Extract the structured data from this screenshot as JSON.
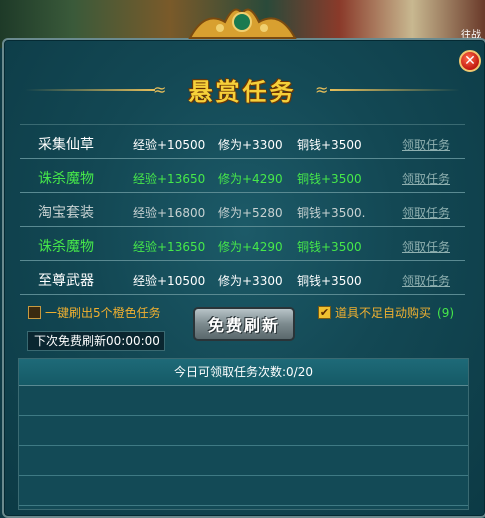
{
  "top": {
    "side_tag": "往战"
  },
  "title": "悬赏任务",
  "tasks": [
    {
      "name": "采集仙草",
      "exp": "经验+10500",
      "cultivation": "修为+3300",
      "coins": "铜钱+3500",
      "action": "领取任务",
      "color": "white"
    },
    {
      "name": "诛杀魔物",
      "exp": "经验+13650",
      "cultivation": "修为+4290",
      "coins": "铜钱+3500",
      "action": "领取任务",
      "color": "green"
    },
    {
      "name": "淘宝套装",
      "exp": "经验+16800",
      "cultivation": "修为+5280",
      "coins": "铜钱+3500.",
      "action": "领取任务",
      "color": "gray"
    },
    {
      "name": "诛杀魔物",
      "exp": "经验+13650",
      "cultivation": "修为+4290",
      "coins": "铜钱+3500",
      "action": "领取任务",
      "color": "green"
    },
    {
      "name": "至尊武器",
      "exp": "经验+10500",
      "cultivation": "修为+3300",
      "coins": "铜钱+3500",
      "action": "领取任务",
      "color": "white"
    }
  ],
  "options": {
    "orange_refresh_label": "一键刷出5个橙色任务",
    "orange_refresh_checked": false,
    "auto_buy_label": "道具不足自动购买",
    "auto_buy_checked": true,
    "auto_buy_count": "(9)"
  },
  "refresh_button": "免费刷新",
  "next_refresh": "下次免费刷新00:00:00",
  "daily_claims": "今日可领取任务次数:0/20",
  "colors": {
    "accent_gold": "#f6d03a",
    "green_text": "#46e84a",
    "panel_bg": "#134854"
  }
}
